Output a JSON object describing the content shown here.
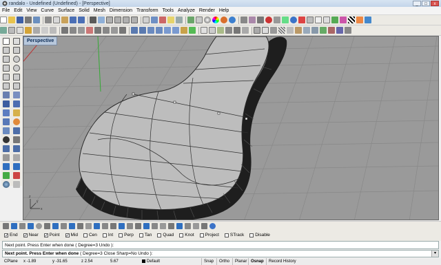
{
  "window": {
    "title": "randalo - Undefined (Undefined) - [Perspective]",
    "buttons": [
      "_",
      "□",
      "x"
    ]
  },
  "menu": [
    "File",
    "Edit",
    "View",
    "Curve",
    "Surface",
    "Solid",
    "Mesh",
    "Dimension",
    "Transform",
    "Tools",
    "Analyze",
    "Render",
    "Help"
  ],
  "viewport": {
    "label": "Perspective",
    "axis_labels": {
      "x": "x",
      "y": "y",
      "z": "z"
    }
  },
  "colors": {
    "grid_bg": "#9a9a9a",
    "grid_line": "#868686",
    "surface": "#bcbcbc",
    "accent": "#0b2b55"
  },
  "osnaps": [
    {
      "label": "End",
      "checked": true
    },
    {
      "label": "Near",
      "checked": true
    },
    {
      "label": "Point",
      "checked": true
    },
    {
      "label": "Mid",
      "checked": true
    },
    {
      "label": "Cen",
      "checked": false
    },
    {
      "label": "Int",
      "checked": false
    },
    {
      "label": "Perp",
      "checked": false
    },
    {
      "label": "Tan",
      "checked": false
    },
    {
      "label": "Quad",
      "checked": false
    },
    {
      "label": "Knot",
      "checked": false
    },
    {
      "label": "Project",
      "checked": false
    },
    {
      "label": "STrack",
      "checked": false
    },
    {
      "label": "Disable",
      "checked": false
    }
  ],
  "command": {
    "history": "Next point. Press Enter when done ( Degree=3  Undo ):",
    "prompt_label": "Next point. Press Enter when done",
    "prompt_options": " ( Degree=3  Close  Sharp=No  Undo ):"
  },
  "status": {
    "cplane": "CPlane",
    "x": "x -1.89",
    "y": "y -31.65",
    "z": "z 2.54",
    "dist": "5.67",
    "layer": "Default",
    "panes": [
      "Snap",
      "Ortho",
      "Planar",
      "Osnap",
      "Record History"
    ],
    "active_pane": "Osnap"
  }
}
